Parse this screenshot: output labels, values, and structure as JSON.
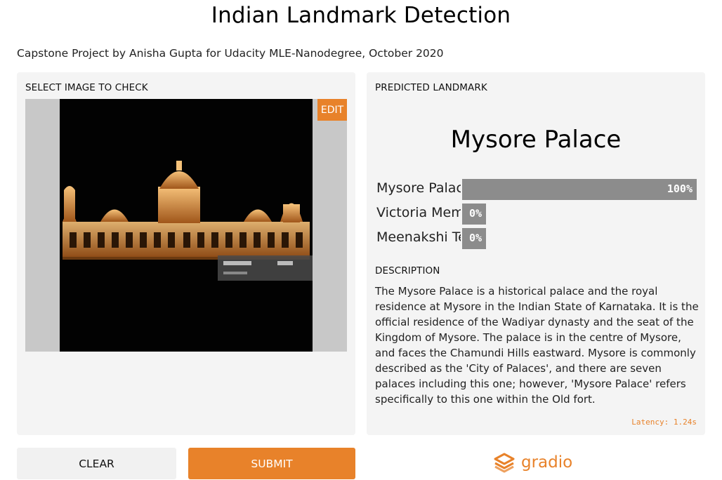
{
  "header": {
    "title": "Indian Landmark Detection",
    "subtitle": "Capstone Project by Anisha Gupta for Udacity MLE-Nanodegree, October 2020"
  },
  "input_panel": {
    "label": "SELECT IMAGE TO CHECK",
    "edit_label": "EDIT",
    "image_icon": "palace-night-photo-icon"
  },
  "output_panel": {
    "label": "PREDICTED LANDMARK",
    "predicted": "Mysore Palace",
    "confidences": [
      {
        "label": "Mysore Palace",
        "percent": "100%",
        "value": 1.0
      },
      {
        "label": "Victoria Memorial",
        "percent": "0%",
        "value": 0.0
      },
      {
        "label": "Meenakshi Temple",
        "percent": "0%",
        "value": 0.0
      }
    ],
    "description_label": "DESCRIPTION",
    "description": "The Mysore Palace is a historical palace and the royal residence at Mysore in the Indian State of Karnataka. It is the official residence of the Wadiyar dynasty and the seat of the Kingdom of Mysore. The palace is in the centre of Mysore, and faces the Chamundi Hills eastward. Mysore is commonly described as the 'City of Palaces', and there are seven palaces including this one; however, 'Mysore Palace' refers specifically to this one within the Old fort.",
    "latency": "Latency: 1.24s"
  },
  "actions": {
    "clear_label": "CLEAR",
    "submit_label": "SUBMIT"
  },
  "brand": {
    "name": "gradio",
    "icon": "gradio-logo-icon",
    "accent": "#e8822a"
  }
}
